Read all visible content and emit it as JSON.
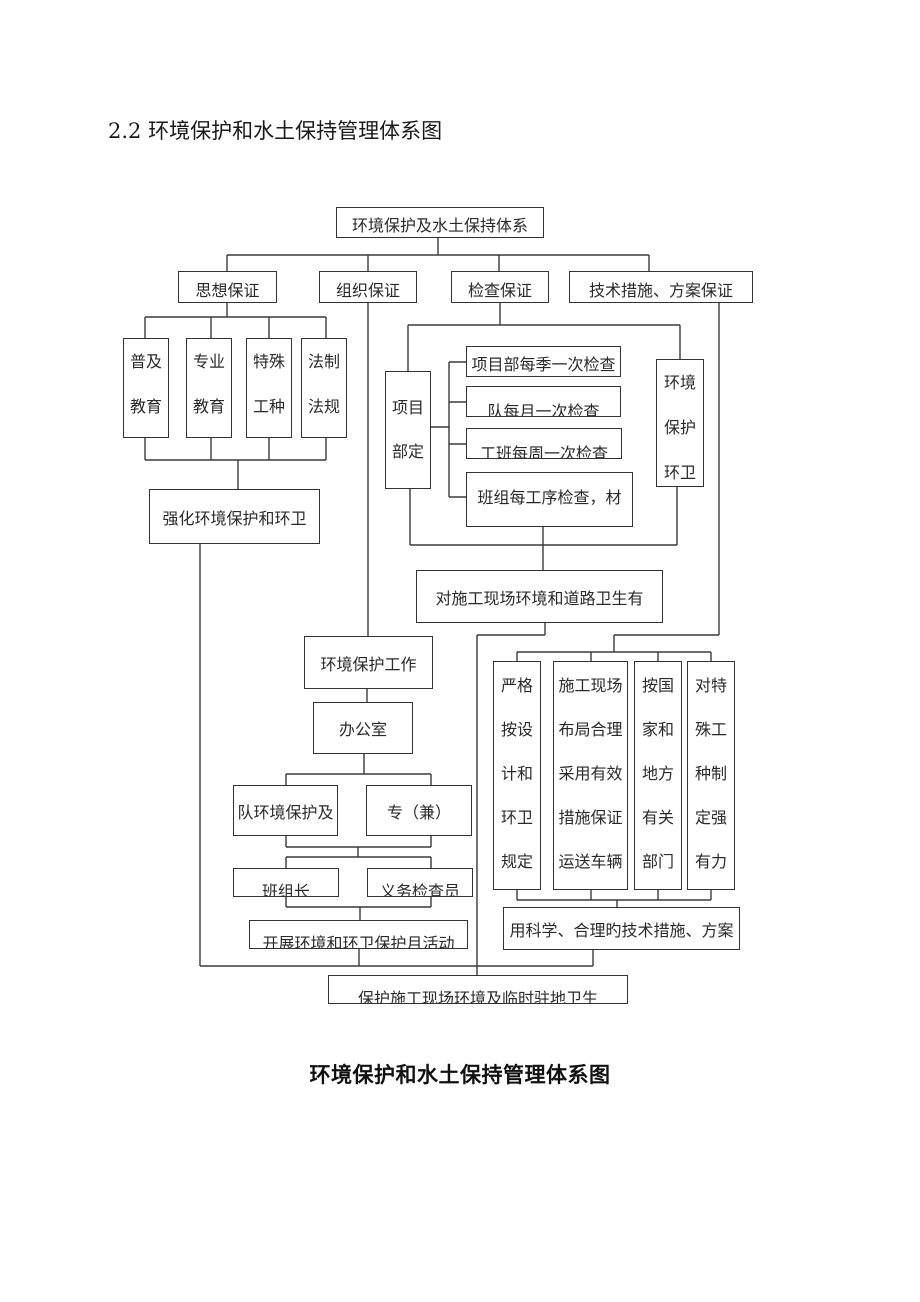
{
  "heading": "2.2 环境保护和水土保持管理体系图",
  "caption": "环境保护和水土保持管理体系图",
  "diagram": {
    "root": "环境保护及水土保持体系",
    "level2": [
      "思想保证",
      "组织保证",
      "检查保证",
      "技术措施、方案保证"
    ],
    "thought": {
      "items": [
        {
          "lines": [
            "普及",
            "教育"
          ]
        },
        {
          "lines": [
            "专业",
            "教育"
          ]
        },
        {
          "lines": [
            "特殊",
            "工种"
          ]
        },
        {
          "lines": [
            "法制",
            "法规"
          ]
        }
      ],
      "result": "强化环境保护和环卫"
    },
    "organization": {
      "office_top": "环境保护工作",
      "office": "办公室",
      "staff": [
        "队环境保护及",
        "专（兼）"
      ],
      "members": [
        "班组长",
        "义务检查员"
      ],
      "activity": "开展环境和环卫保护月活动"
    },
    "inspection": {
      "project_dept": {
        "lines": [
          "项目",
          "部定"
        ]
      },
      "schedules": [
        "项目部每季一次检查",
        "队每月一次检查",
        "工班每周一次检查",
        "班组每工序检查，材"
      ],
      "env_sanitation": {
        "lines": [
          "环境",
          "保护",
          "环卫"
        ]
      },
      "result": "对施工现场环境和道路卫生有"
    },
    "technical": {
      "items": [
        {
          "lines": [
            "严格",
            "按设",
            "计和",
            "环卫",
            "规定"
          ]
        },
        {
          "lines": [
            "施工现场",
            "布局合理",
            "采用有效",
            "措施保证",
            "运送车辆"
          ]
        },
        {
          "lines": [
            "按国",
            "家和",
            "地方",
            "有关",
            "部门"
          ]
        },
        {
          "lines": [
            "对特",
            "殊工",
            "种制",
            "定强",
            "有力"
          ]
        }
      ],
      "result": "用科学、合理旳技术措施、方案"
    },
    "final": "保护施工现场环境及临时驻地卫生"
  }
}
